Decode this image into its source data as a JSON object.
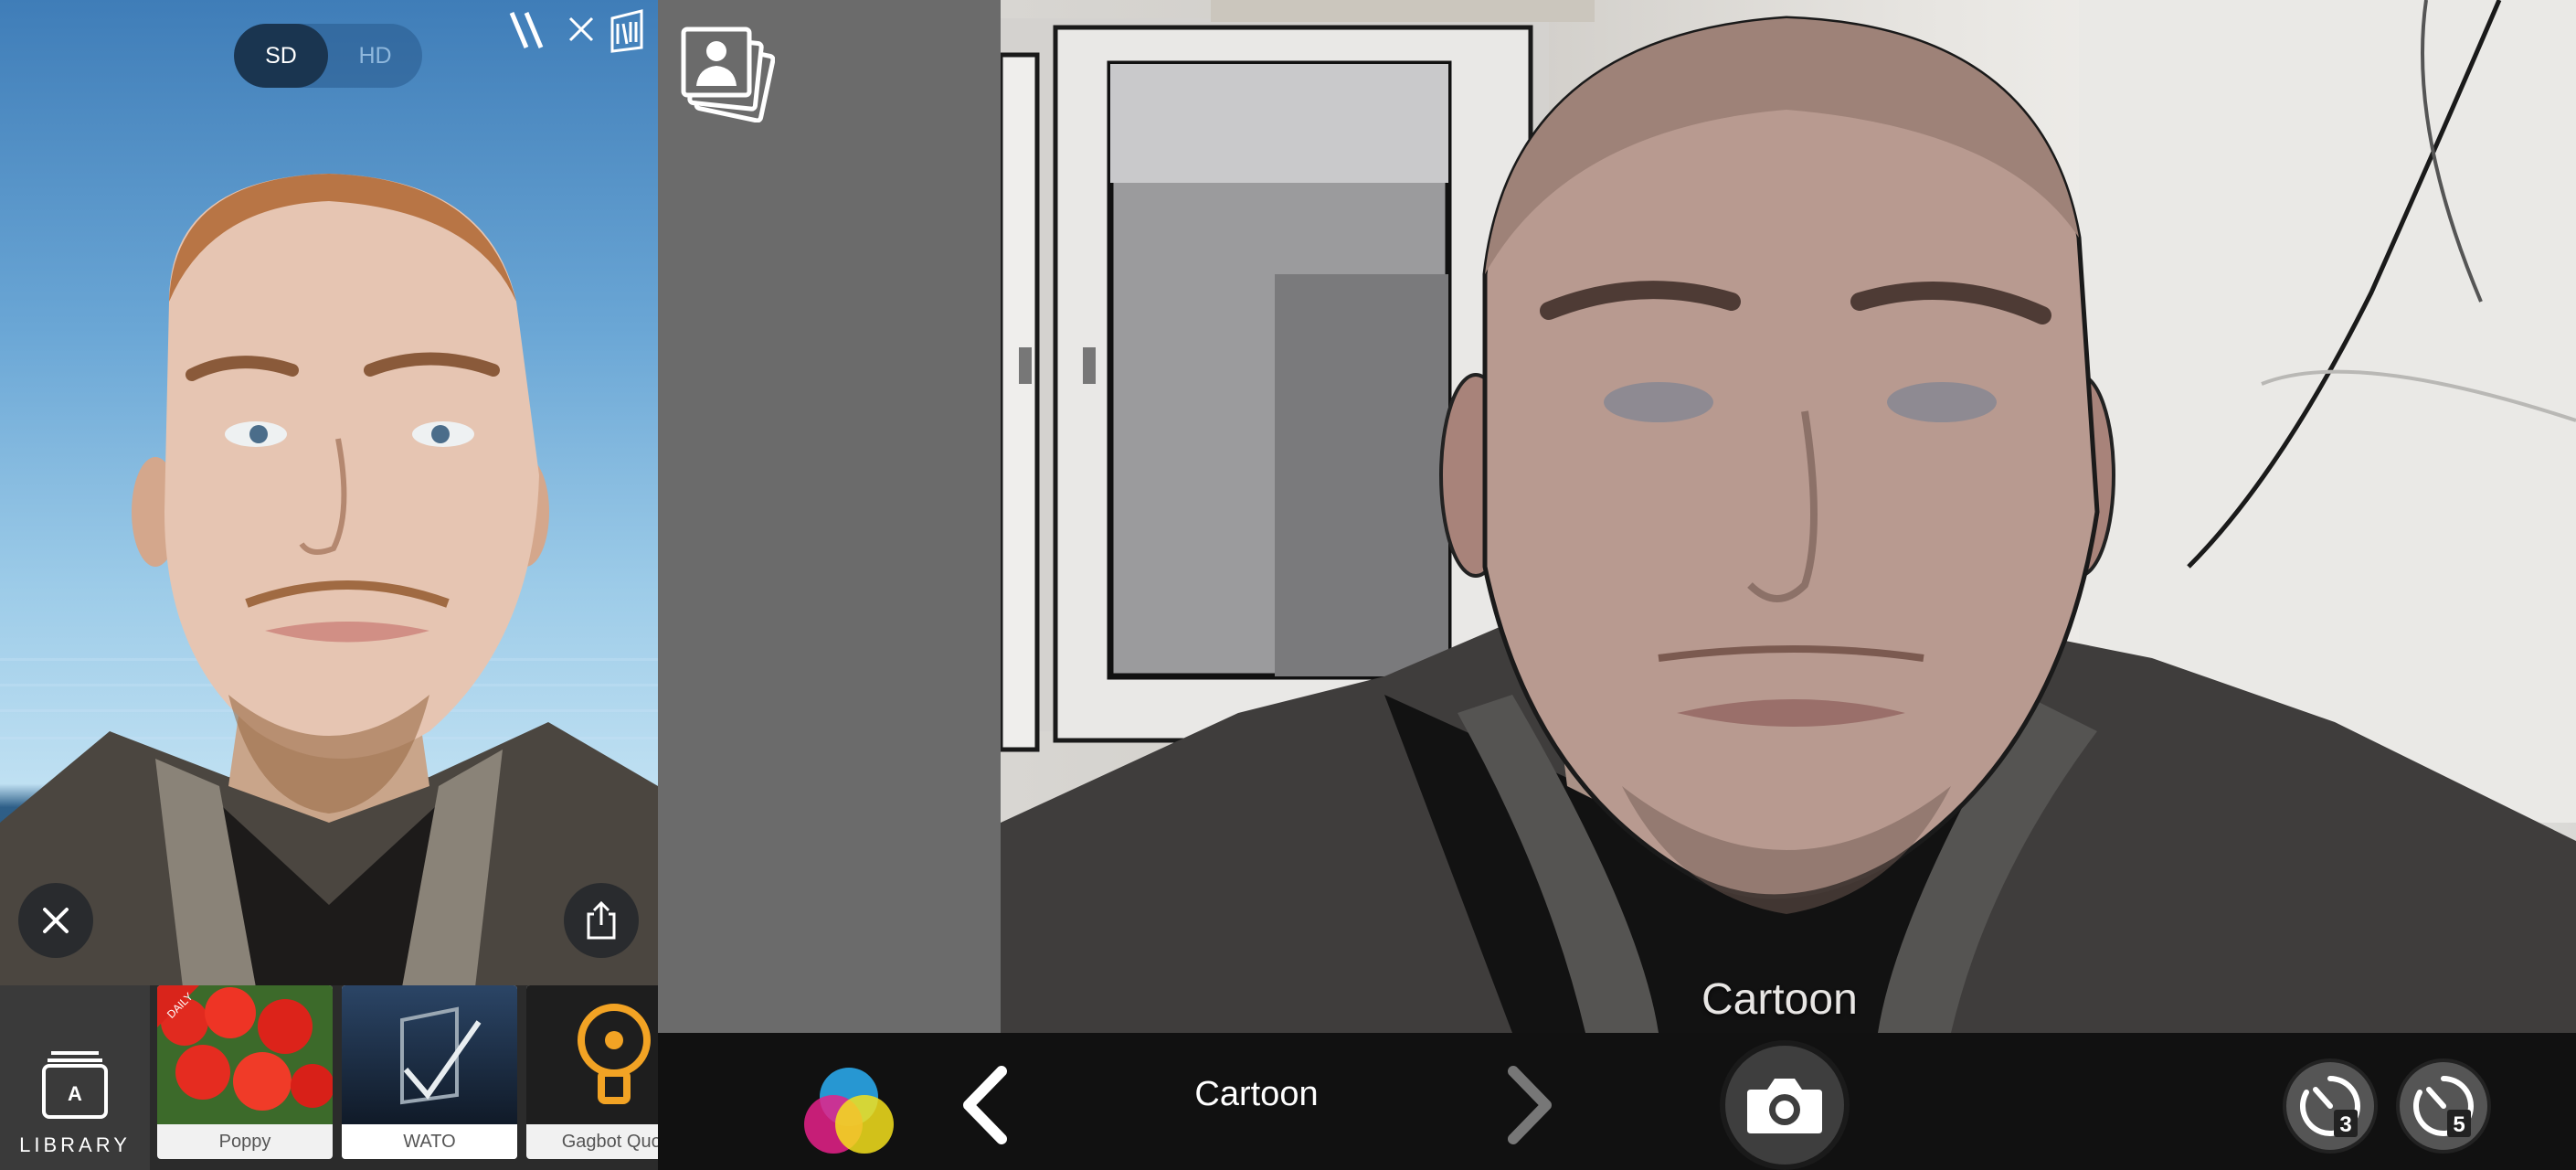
{
  "left_app": {
    "quality_toggle": {
      "sd_label": "SD",
      "hd_label": "HD",
      "selected": "SD"
    },
    "top_icons": [
      "brand-logo-icon",
      "close-icon",
      "app-logo-icon"
    ],
    "close_button_icon": "close-icon",
    "share_button_icon": "share-icon",
    "filter_strip": {
      "library_label": "LIBRARY",
      "library_badge": "A",
      "tiles": [
        {
          "name": "Poppy",
          "badge": "DAILY"
        },
        {
          "name": "WATO"
        },
        {
          "name": "Gagbot Quot"
        }
      ]
    }
  },
  "camera_app": {
    "mode_overlay": "Cartoon",
    "mode_name": "Cartoon",
    "gallery_icon": "gallery-stack-icon",
    "color_icon": "color-circles-icon",
    "prev_icon": "chevron-left-icon",
    "next_icon": "chevron-right-icon",
    "shutter_icon": "camera-icon",
    "timers": [
      {
        "label": "3",
        "icon": "timer-3-icon"
      },
      {
        "label": "5",
        "icon": "timer-5-icon"
      }
    ]
  }
}
